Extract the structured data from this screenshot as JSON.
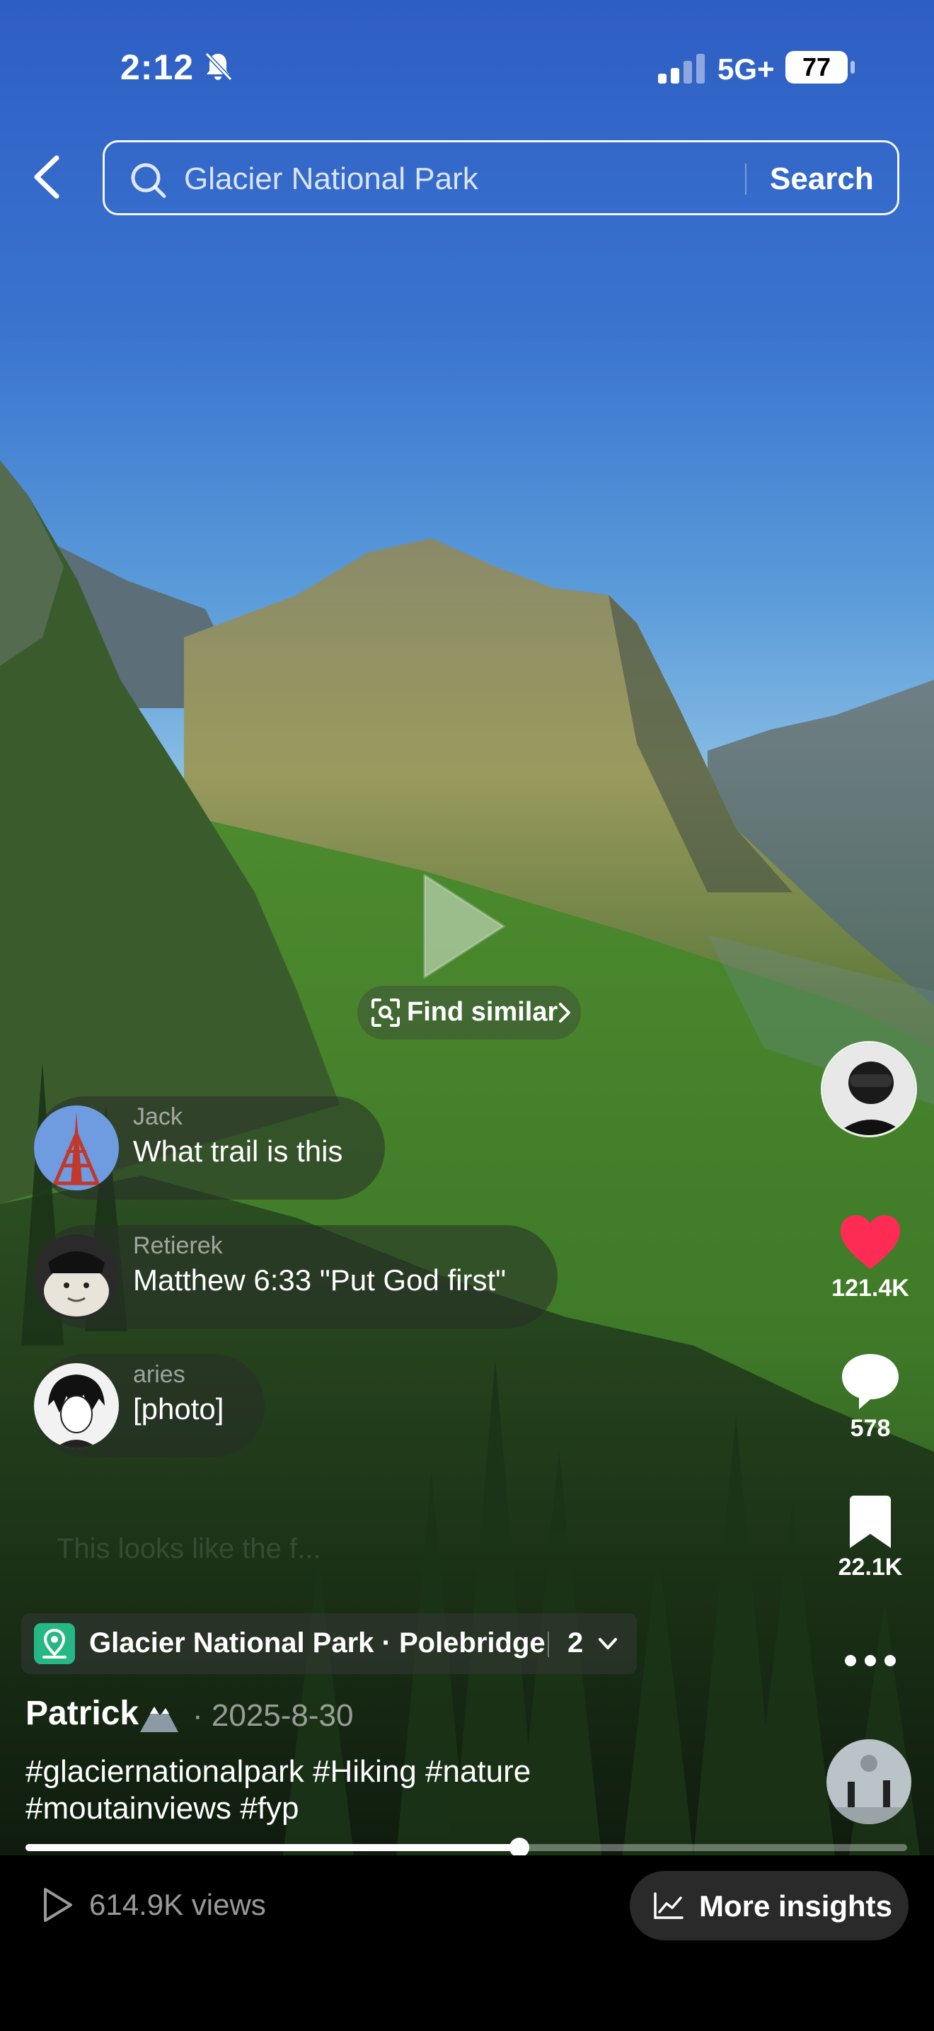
{
  "status_bar": {
    "time": "2:12",
    "network": "5G+",
    "battery": "77",
    "icons": [
      "bell-slash-icon",
      "signal-icon",
      "battery-icon"
    ]
  },
  "search": {
    "query": "Glacier National Park",
    "button_label": "Search"
  },
  "video": {
    "find_similar_label": "Find similar"
  },
  "comments": [
    {
      "name": "Jack",
      "text": "What trail is this"
    },
    {
      "name": "Retierek",
      "text": "Matthew 6:33 \"Put God first\""
    },
    {
      "name": "aries",
      "text": "[photo]"
    }
  ],
  "faded_comment": "This looks like the f...",
  "actions": {
    "likes": "121.4K",
    "comments": "578",
    "saves": "22.1K"
  },
  "location": {
    "label": "Glacier National Park · Polebridge",
    "count": "2"
  },
  "post": {
    "author": "Patrick",
    "date": "· 2025-8-30",
    "caption_line1": "#glaciernationalpark #Hiking #nature",
    "caption_line2": "#moutainviews #fyp",
    "progress": 0.56
  },
  "footer": {
    "views": "614.9K views",
    "insights_label": "More insights"
  },
  "colors": {
    "like": "#fe2c55",
    "location_badge": "#25b884"
  }
}
